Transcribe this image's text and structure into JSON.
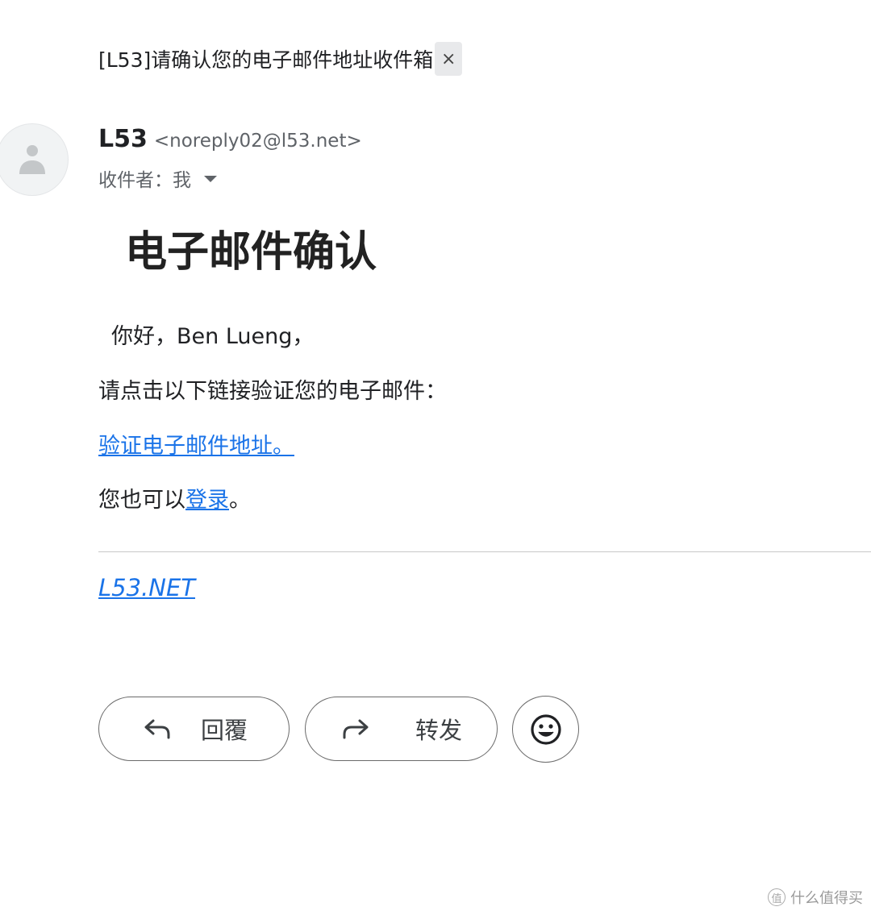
{
  "email": {
    "subject": "[L53]请确认您的电子邮件地址",
    "label": "收件箱",
    "label_close": "×",
    "sender": {
      "name": "L53",
      "email": "<noreply02@l53.net>",
      "avatar_icon": "person-icon"
    },
    "recipient": "收件者：我"
  },
  "body": {
    "headline": "电子邮件确认",
    "greeting": "你好，Ben Lueng，",
    "instruction": "请点击以下链接验证您的电子邮件：",
    "verify_link": "验证电子邮件地址。",
    "alt_prefix": "您也可以",
    "login_link": "登录",
    "alt_suffix": "。",
    "footer_link": "L53.NET"
  },
  "actions": {
    "reply": {
      "label": "回覆",
      "icon": "reply-icon"
    },
    "forward": {
      "label": "转发",
      "icon": "forward-icon"
    },
    "emoji": {
      "icon": "emoji-smile-icon"
    }
  },
  "watermark": {
    "symbol": "值",
    "text": "什么值得买"
  },
  "colors": {
    "link": "#1a73e8",
    "text": "#202124",
    "muted": "#5f6368"
  }
}
